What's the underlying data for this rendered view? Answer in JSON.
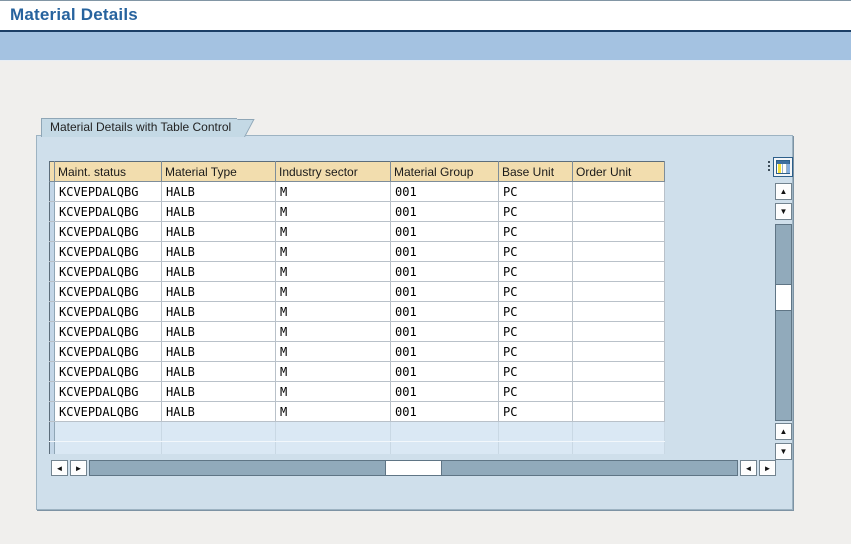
{
  "window": {
    "title": "Material Details"
  },
  "tabstrip": {
    "tabs": [
      {
        "label": "Material Details with Table Control",
        "active": true
      }
    ]
  },
  "table": {
    "columns": [
      "Maint. status",
      "Material Type",
      "Industry sector",
      "Material Group",
      "Base Unit",
      "Order Unit"
    ],
    "rows": [
      [
        "KCVEPDALQBG",
        "HALB",
        "M",
        "001",
        "PC",
        ""
      ],
      [
        "KCVEPDALQBG",
        "HALB",
        "M",
        "001",
        "PC",
        ""
      ],
      [
        "KCVEPDALQBG",
        "HALB",
        "M",
        "001",
        "PC",
        ""
      ],
      [
        "KCVEPDALQBG",
        "HALB",
        "M",
        "001",
        "PC",
        ""
      ],
      [
        "KCVEPDALQBG",
        "HALB",
        "M",
        "001",
        "PC",
        ""
      ],
      [
        "KCVEPDALQBG",
        "HALB",
        "M",
        "001",
        "PC",
        ""
      ],
      [
        "KCVEPDALQBG",
        "HALB",
        "M",
        "001",
        "PC",
        ""
      ],
      [
        "KCVEPDALQBG",
        "HALB",
        "M",
        "001",
        "PC",
        ""
      ],
      [
        "KCVEPDALQBG",
        "HALB",
        "M",
        "001",
        "PC",
        ""
      ],
      [
        "KCVEPDALQBG",
        "HALB",
        "M",
        "001",
        "PC",
        ""
      ],
      [
        "KCVEPDALQBG",
        "HALB",
        "M",
        "001",
        "PC",
        ""
      ],
      [
        "KCVEPDALQBG",
        "HALB",
        "M",
        "001",
        "PC",
        ""
      ]
    ],
    "empty_row_count": 2
  },
  "scrollbars": {
    "glyphs": {
      "up": "▲",
      "down": "▼",
      "left": "◄",
      "right": "►"
    }
  },
  "icons": {
    "table_settings": "table-settings-icon"
  },
  "colors": {
    "title-text": "#27639e",
    "title-underline": "#1c3f66",
    "top-band": "#a4c2e1",
    "page-bg": "#f0efed",
    "panel-bg": "#cfdfeb",
    "tab-bg": "#c4d9e5",
    "header-bg": "#f2ddae",
    "row-selector-bg": "#c3d6e7",
    "empty-row-bg": "#dae8f4",
    "track": "#91aabb",
    "grid-line": "#b9c1c9",
    "table-border": "#5c6d7b"
  }
}
